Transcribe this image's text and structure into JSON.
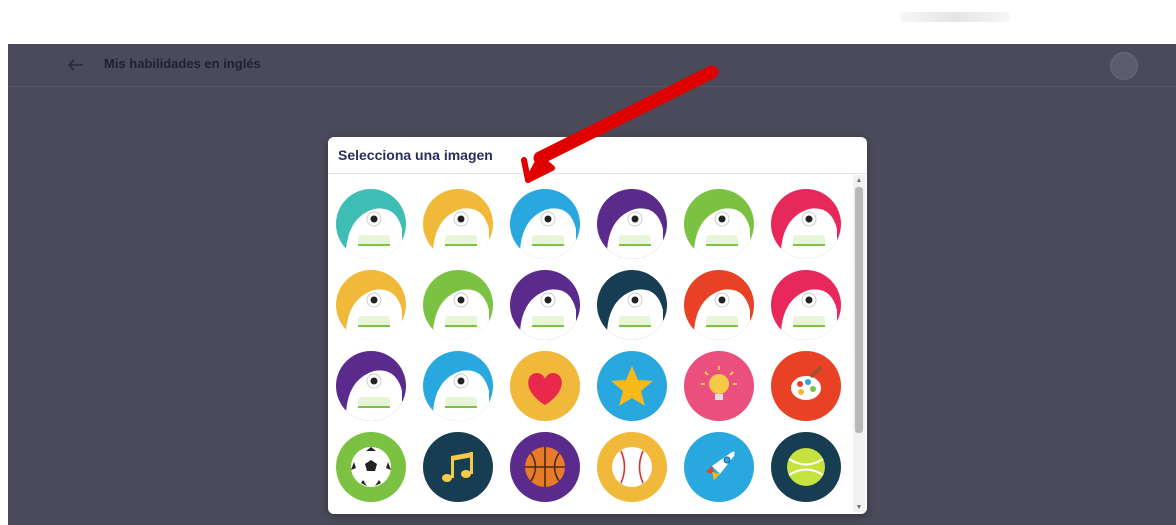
{
  "header": {
    "title": "Mis habilidades en inglés"
  },
  "background": {
    "heading": ""
  },
  "modal": {
    "title": "Selecciona una imagen"
  },
  "avatars": [
    {
      "name": "monster-green-teal",
      "bg": "#3dbdb3"
    },
    {
      "name": "monster-sleepy-yellow",
      "bg": "#f0b93a"
    },
    {
      "name": "monster-blue-bear",
      "bg": "#29a8e0"
    },
    {
      "name": "monster-laptop-purple",
      "bg": "#5a2a8c"
    },
    {
      "name": "monster-bed-green",
      "bg": "#7cc242"
    },
    {
      "name": "monster-astronaut-pink",
      "bg": "#e6285a"
    },
    {
      "name": "monster-reading-yellow",
      "bg": "#f0b93a"
    },
    {
      "name": "monster-soccer-green",
      "bg": "#7cc242"
    },
    {
      "name": "monster-propeller-purple",
      "bg": "#5a2a8c"
    },
    {
      "name": "monster-detective-navy",
      "bg": "#173d52"
    },
    {
      "name": "monster-hat-red",
      "bg": "#e84125"
    },
    {
      "name": "monster-smiling-pink",
      "bg": "#e6285a"
    },
    {
      "name": "monster-flag-purple",
      "bg": "#5a2a8c"
    },
    {
      "name": "monster-peek-blue",
      "bg": "#29a8e0"
    },
    {
      "name": "heart-icon",
      "bg": "#f0b93a"
    },
    {
      "name": "star-icon",
      "bg": "#29a8e0"
    },
    {
      "name": "lightbulb-icon",
      "bg": "#ea4f7e"
    },
    {
      "name": "paint-palette-icon",
      "bg": "#e84125"
    },
    {
      "name": "soccer-ball-icon",
      "bg": "#7cc242"
    },
    {
      "name": "music-notes-icon",
      "bg": "#173d52"
    },
    {
      "name": "basketball-icon",
      "bg": "#5a2a8c"
    },
    {
      "name": "baseball-icon",
      "bg": "#f0b93a"
    },
    {
      "name": "rocket-icon",
      "bg": "#29a8e0"
    },
    {
      "name": "tennis-ball-icon",
      "bg": "#173d52"
    }
  ],
  "colors": {
    "overlay": "#4a4a5a",
    "modal_title": "#2a2e5a",
    "annotation_arrow": "#e00000"
  }
}
